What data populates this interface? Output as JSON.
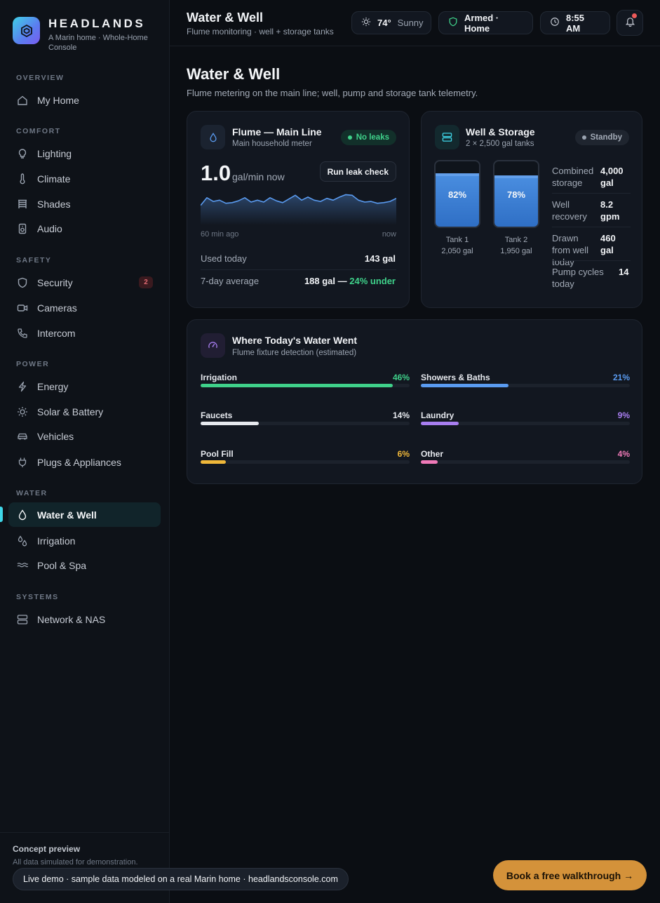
{
  "brand": {
    "name": "HEADLANDS",
    "subtitle": "A Marin home · Whole-Home Console"
  },
  "nav": {
    "sections": [
      {
        "title": "OVERVIEW",
        "items": [
          {
            "label": "My Home",
            "icon": "home-icon"
          }
        ]
      },
      {
        "title": "COMFORT",
        "items": [
          {
            "label": "Lighting",
            "icon": "bulb-icon"
          },
          {
            "label": "Climate",
            "icon": "thermometer-icon"
          },
          {
            "label": "Shades",
            "icon": "blinds-icon"
          },
          {
            "label": "Audio",
            "icon": "speaker-icon"
          }
        ]
      },
      {
        "title": "SAFETY",
        "items": [
          {
            "label": "Security",
            "icon": "shield-icon",
            "badge": "2"
          },
          {
            "label": "Cameras",
            "icon": "camera-icon"
          },
          {
            "label": "Intercom",
            "icon": "phone-icon"
          }
        ]
      },
      {
        "title": "POWER",
        "items": [
          {
            "label": "Energy",
            "icon": "bolt-icon"
          },
          {
            "label": "Solar & Battery",
            "icon": "sun-icon"
          },
          {
            "label": "Vehicles",
            "icon": "car-icon"
          },
          {
            "label": "Plugs & Appliances",
            "icon": "plug-icon"
          }
        ]
      },
      {
        "title": "WATER",
        "items": [
          {
            "label": "Water & Well",
            "icon": "drop-icon",
            "active": true
          },
          {
            "label": "Irrigation",
            "icon": "droplets-icon"
          },
          {
            "label": "Pool & Spa",
            "icon": "waves-icon"
          }
        ]
      },
      {
        "title": "SYSTEMS",
        "items": [
          {
            "label": "Network & NAS",
            "icon": "server-icon"
          }
        ]
      }
    ]
  },
  "footer": {
    "title": "Concept preview",
    "text": "All data simulated for demonstration."
  },
  "topbar": {
    "title": "Water & Well",
    "subtitle": "Flume monitoring · well + storage tanks",
    "weather_temp": "74°",
    "weather_cond": "Sunny",
    "security": "Armed · Home",
    "time": "8:55 AM"
  },
  "page": {
    "title": "Water & Well",
    "subtitle": "Flume metering on the main line; well, pump and storage tank telemetry."
  },
  "flume": {
    "title": "Flume — Main Line",
    "subtitle": "Main household meter",
    "status": "No leaks",
    "flow_value": "1.0",
    "flow_unit": "gal/min now",
    "button": "Run leak check",
    "axis_start": "60 min ago",
    "axis_end": "now",
    "used_label": "Used today",
    "used_value": "143 gal",
    "avg_label": "7-day average",
    "avg_value": "188 gal — ",
    "avg_delta": "24% under",
    "flow_series": [
      0.55,
      0.8,
      0.68,
      0.72,
      0.62,
      0.64,
      0.7,
      0.8,
      0.66,
      0.72,
      0.66,
      0.8,
      0.7,
      0.64,
      0.76,
      0.88,
      0.72,
      0.82,
      0.72,
      0.68,
      0.78,
      0.72,
      0.82,
      0.9,
      0.88,
      0.72,
      0.66,
      0.68,
      0.62,
      0.64,
      0.68,
      0.78
    ]
  },
  "well": {
    "title": "Well & Storage",
    "subtitle": "2 × 2,500 gal tanks",
    "status": "Standby",
    "tanks": [
      {
        "pct": "82%",
        "level": 0.82,
        "name": "Tank 1",
        "volume": "2,050 gal"
      },
      {
        "pct": "78%",
        "level": 0.78,
        "name": "Tank 2",
        "volume": "1,950 gal"
      }
    ],
    "stats": [
      {
        "label": "Combined storage",
        "value": "4,000 gal"
      },
      {
        "label": "Well recovery",
        "value": "8.2 gpm"
      },
      {
        "label": "Drawn from well today",
        "value": "460 gal"
      },
      {
        "label": "Pump cycles today",
        "value": "14"
      }
    ]
  },
  "usage": {
    "title": "Where Today's Water Went",
    "subtitle": "Flume fixture detection (estimated)",
    "items": [
      {
        "label": "Irrigation",
        "pct": "46%",
        "value": 46,
        "color": "#3fd18a"
      },
      {
        "label": "Showers & Baths",
        "pct": "21%",
        "value": 21,
        "color": "#5a9bf0"
      },
      {
        "label": "Faucets",
        "pct": "14%",
        "value": 14,
        "color": "#e6e9ee"
      },
      {
        "label": "Laundry",
        "pct": "9%",
        "value": 9,
        "color": "#a87ef0"
      },
      {
        "label": "Pool Fill",
        "pct": "6%",
        "value": 6,
        "color": "#f0b83a"
      },
      {
        "label": "Other",
        "pct": "4%",
        "value": 4,
        "color": "#f07ab8"
      }
    ]
  },
  "toast": "Live demo · sample data modeled on a real Marin home · headlandsconsole.com",
  "cta": "Book a free walkthrough →",
  "colors": {
    "accent": "#3fd6e8",
    "cta": "#d4923a",
    "positive": "#3fd18a",
    "chart_line": "#5a9bf0"
  }
}
